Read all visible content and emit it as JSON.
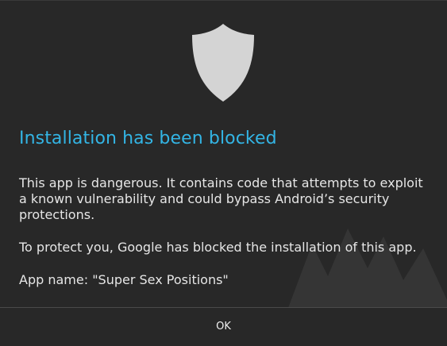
{
  "dialog": {
    "icon": "shield-icon",
    "title": "Installation has been blocked",
    "message_paragraphs": [
      "This app is dangerous. It contains code that attempts to exploit a known vulnerability and could bypass Android’s security protections.",
      "To protect you, Google has blocked the installation of this app.",
      "App name: \"Super Sex Positions\""
    ],
    "ok_label": "OK"
  },
  "colors": {
    "background": "#282828",
    "title": "#33b5e5",
    "text": "#e6e6e6",
    "shield": "#d4d4d4"
  }
}
